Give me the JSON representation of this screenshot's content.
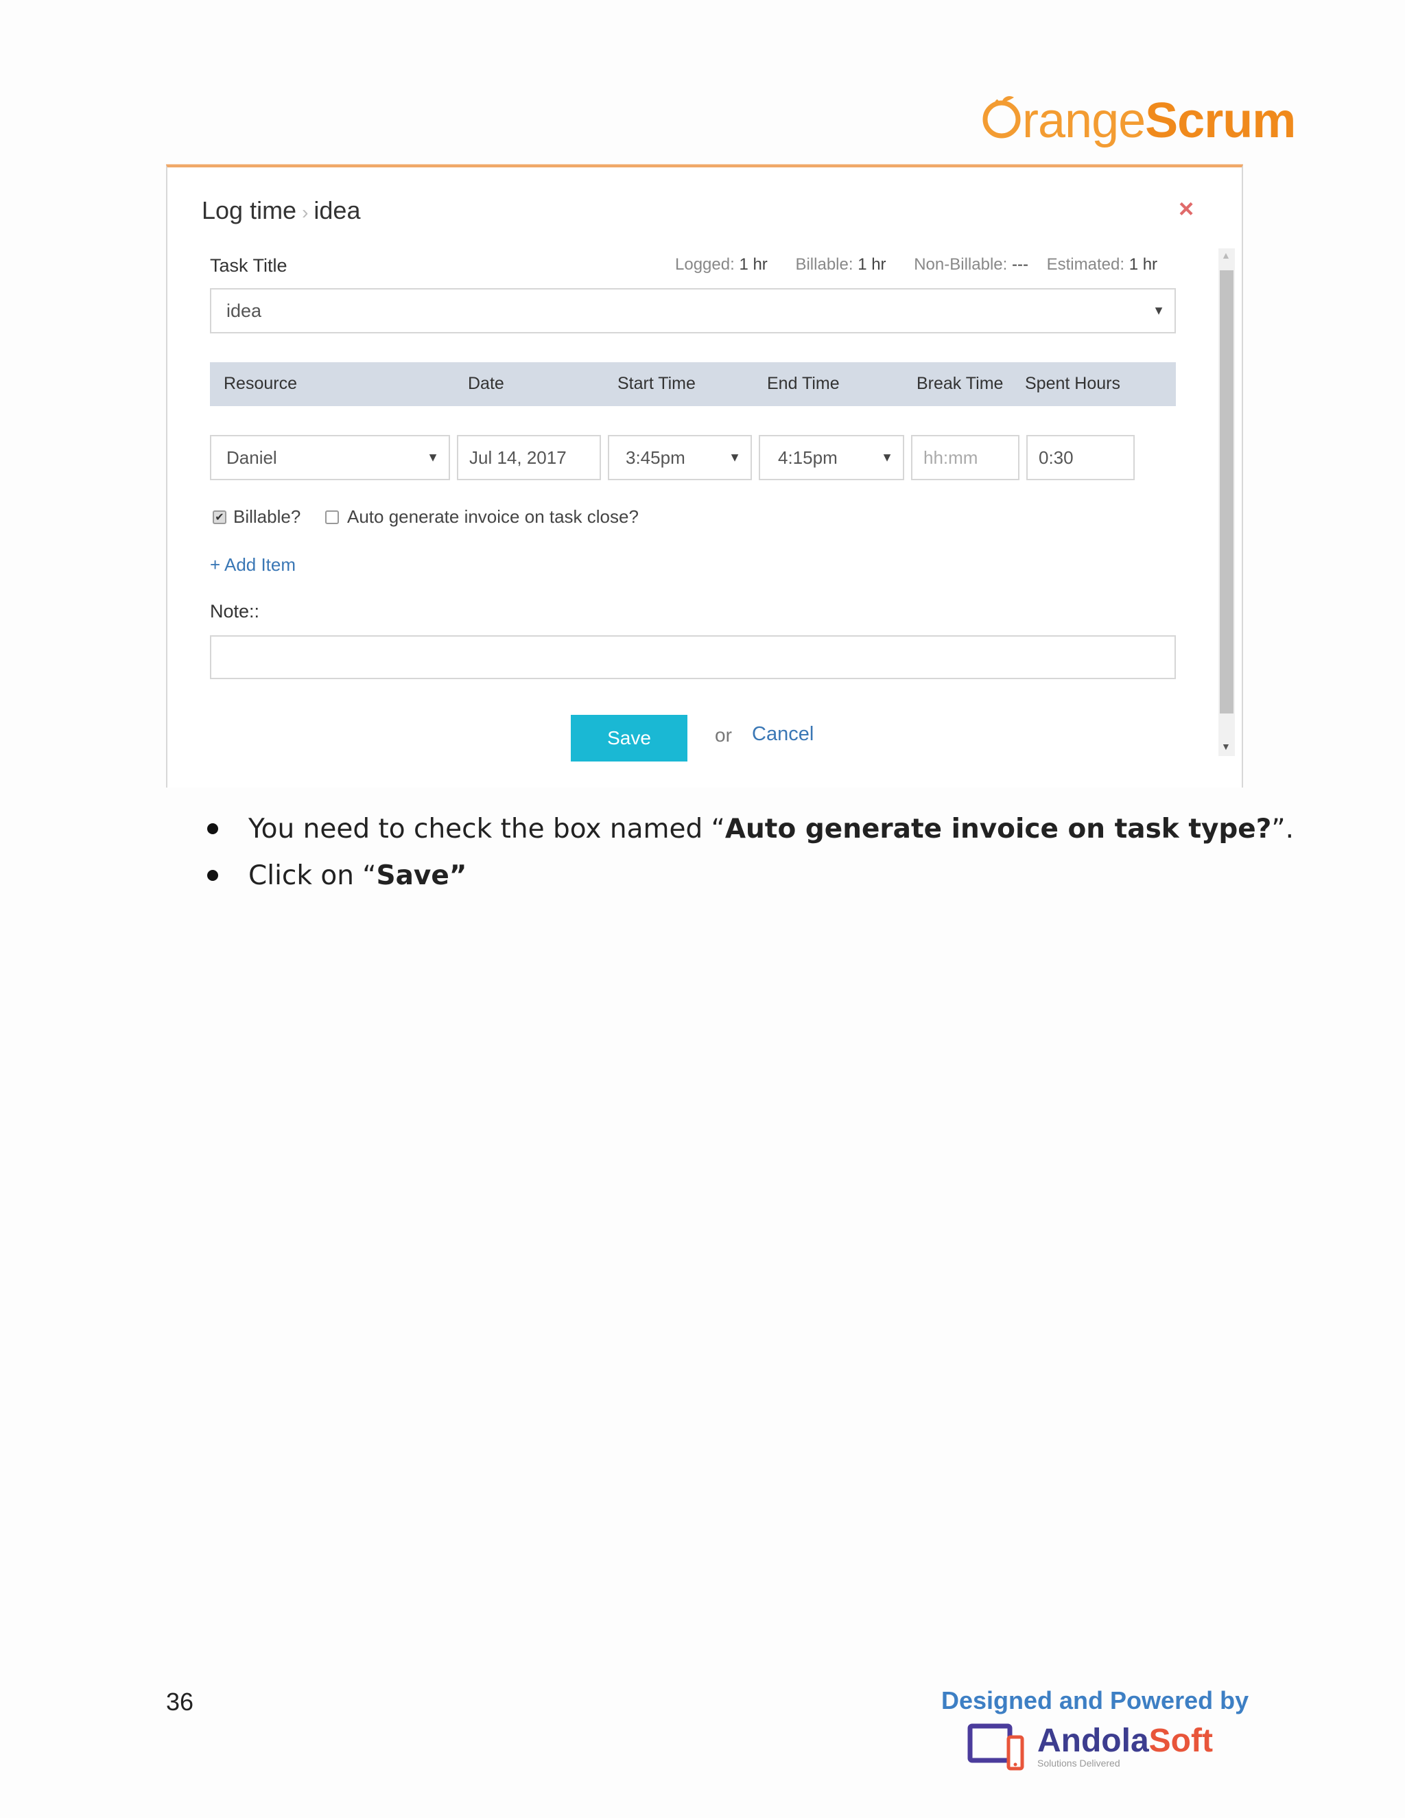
{
  "brand": {
    "logo_text_light": "range",
    "logo_text_bold": "Scrum"
  },
  "dialog": {
    "title": "Log time",
    "title_sep": "›",
    "title_task": "idea",
    "close_glyph": "×",
    "task_title_label": "Task Title",
    "stats": {
      "logged_label": "Logged:",
      "logged_value": "1 hr",
      "billable_label": "Billable:",
      "billable_value": "1 hr",
      "nonbillable_label": "Non-Billable:",
      "nonbillable_value": "---",
      "estimated_label": "Estimated:",
      "estimated_value": "1 hr"
    },
    "task_select_value": "idea",
    "table_headers": [
      "Resource",
      "Date",
      "Start Time",
      "End Time",
      "Break Time",
      "Spent Hours"
    ],
    "row": {
      "resource": "Daniel",
      "date": "Jul 14, 2017",
      "start_time": "3:45pm",
      "end_time": "4:15pm",
      "break_time_placeholder": "hh:mm",
      "spent_hours": "0:30"
    },
    "billable_label": "Billable?",
    "billable_checked": true,
    "auto_invoice_label": "Auto generate invoice on task close?",
    "auto_invoice_checked": false,
    "add_item_label": "+ Add Item",
    "note_label": "Note::",
    "note_value": "",
    "save_label": "Save",
    "or_label": "or",
    "cancel_label": "Cancel"
  },
  "instructions": {
    "bullet1_pre": "You need to check the box named “",
    "bullet1_bold": "Auto generate invoice on task type?",
    "bullet1_post": "”.",
    "bullet2_pre": "Click on “",
    "bullet2_bold": "Save”"
  },
  "footer": {
    "page_number": "36",
    "designed_by": "Designed and Powered by",
    "company_part1": "Andola",
    "company_part2": "Soft",
    "tagline": "Solutions Delivered"
  },
  "colors": {
    "accent_orange": "#f39c32",
    "save_button": "#1ab8d4",
    "link_blue": "#3a77b5",
    "footer_blue": "#3d7fc4"
  }
}
